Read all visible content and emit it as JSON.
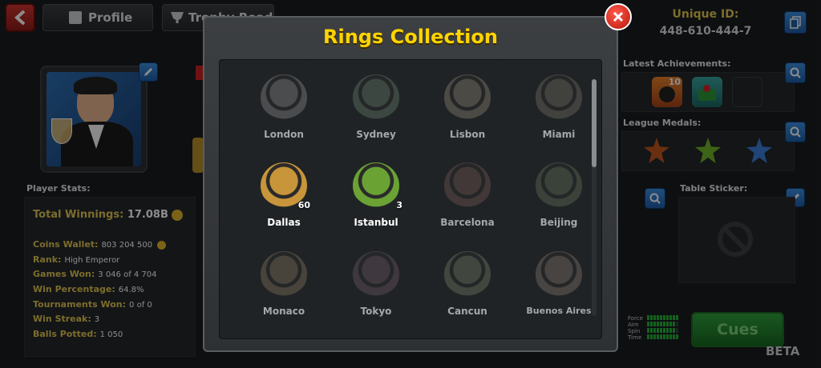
{
  "header": {
    "profile_tab": "Profile",
    "trophy_tab": "Trophy Road",
    "unique_id_label": "Unique ID:",
    "unique_id_value": "448-610-444-7"
  },
  "player": {
    "stats_label": "Player Stats:",
    "total_winnings_label": "Total Winnings:",
    "total_winnings_value": "17.08B",
    "stats": [
      {
        "label": "Coins Wallet:",
        "value": "803 204 500"
      },
      {
        "label": "Rank:",
        "value": "High Emperor"
      },
      {
        "label": "Games Won:",
        "value": "3 046 of 4 704"
      },
      {
        "label": "Win Percentage:",
        "value": "64.8%"
      },
      {
        "label": "Tournaments Won:",
        "value": "0 of 0"
      },
      {
        "label": "Win Streak:",
        "value": "3"
      },
      {
        "label": "Balls Potted:",
        "value": "1 050"
      }
    ]
  },
  "side": {
    "latest_achievements": "Latest Achievements:",
    "achievement_badge": "10",
    "league_medals": "League Medals:",
    "table_sticker": "Table Sticker:",
    "cue_stats": [
      {
        "label": "Force",
        "level": 10
      },
      {
        "label": "Aim",
        "level": 9
      },
      {
        "label": "Spin",
        "level": 9
      },
      {
        "label": "Time",
        "level": 10
      }
    ],
    "cues_button": "Cues",
    "beta": "BETA"
  },
  "modal": {
    "title": "Rings Collection",
    "rings": [
      {
        "name": "London",
        "owned": false,
        "count": "",
        "color": "#7a7f86"
      },
      {
        "name": "Sydney",
        "owned": false,
        "count": "",
        "color": "#4f7a52"
      },
      {
        "name": "Lisbon",
        "owned": false,
        "count": "",
        "color": "#8a7a55"
      },
      {
        "name": "Miami",
        "owned": false,
        "count": "",
        "color": "#6f6a4e"
      },
      {
        "name": "Dallas",
        "owned": true,
        "count": "60",
        "color": "#c8953a"
      },
      {
        "name": "Istanbul",
        "owned": true,
        "count": "3",
        "color": "#6aa334"
      },
      {
        "name": "Barcelona",
        "owned": false,
        "count": "",
        "color": "#8a4a44"
      },
      {
        "name": "Beijing",
        "owned": false,
        "count": "",
        "color": "#4e6e3c"
      },
      {
        "name": "Monaco",
        "owned": false,
        "count": "",
        "color": "#8a6a38"
      },
      {
        "name": "Tokyo",
        "owned": false,
        "count": "",
        "color": "#7a4a6a"
      },
      {
        "name": "Cancun",
        "owned": false,
        "count": "",
        "color": "#5e7a40"
      },
      {
        "name": "Buenos Aires",
        "owned": false,
        "count": "",
        "color": "#8a6a5a"
      }
    ]
  }
}
